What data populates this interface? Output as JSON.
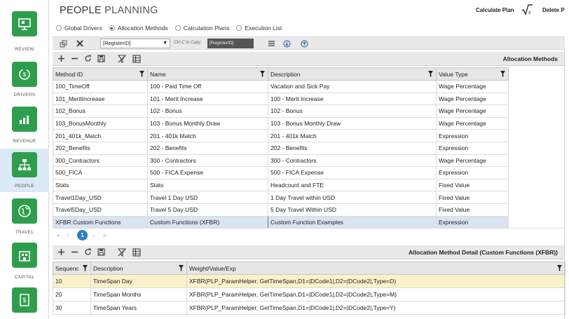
{
  "app": {
    "title_bold": "PEOPLE",
    "title_light": " PLANNING",
    "calculate_plan": "Calculate Plan",
    "delete_plan": "Delete P"
  },
  "sidebar": {
    "items": [
      {
        "label": "REVIEW",
        "icon": "presentation-icon"
      },
      {
        "label": "DRIVERS",
        "icon": "cycle-icon"
      },
      {
        "label": "REVENUE",
        "icon": "revenue-chart-icon"
      },
      {
        "label": "PEOPLE",
        "icon": "org-chart-icon"
      },
      {
        "label": "TRAVEL",
        "icon": "globe-icon"
      },
      {
        "label": "CAPITAL",
        "icon": "building-icon"
      },
      {
        "label": "",
        "icon": "dollar-document-icon"
      }
    ]
  },
  "tabs": [
    {
      "label": "Global Drivers",
      "selected": false
    },
    {
      "label": "Allocation Methods",
      "selected": true
    },
    {
      "label": "Calculation Plans",
      "selected": false
    },
    {
      "label": "Execution List",
      "selected": false
    }
  ],
  "toolbar": {
    "register_value": "[RegisterID]",
    "copy_label": "Ctrl-C to Copy:",
    "copy_value": "[RegisterID]"
  },
  "methods": {
    "title": "Allocation Methods",
    "columns": [
      "Method ID",
      "Name",
      "Description",
      "Value Type"
    ],
    "rows": [
      [
        "100_TimeOff",
        "100 - Paid Time Off",
        "Vacation and Sick Pay",
        "Wage Percentage"
      ],
      [
        "101_MeritIncrease",
        "101 - Merit Increase",
        "100 - Merit Increase",
        "Wage Percentage"
      ],
      [
        "102_Bonus",
        "102 - Bonus",
        "102 - Bonus",
        "Wage Percentage"
      ],
      [
        "103_BonusMonthly",
        "103 - Bonus Monthly Draw",
        "103 - Bonus Monthly Draw",
        "Wage Percentage"
      ],
      [
        "201_401k_Match",
        "201 - 401k Match",
        "201 - 401k Match",
        "Expression"
      ],
      [
        "202_Benefits",
        "202 - Benefits",
        "202 - Benefits",
        "Expression"
      ],
      [
        "300_Contractors",
        "300 - Contractors",
        "300 - Contractors",
        "Wage Percentage"
      ],
      [
        "500_FICA",
        "500 - FICA Expense",
        "500 - FICA Expense",
        "Expression"
      ],
      [
        "Stats",
        "Stats",
        "Headcount and FTE",
        "Fixed Value"
      ],
      [
        "Travel1Day_USD",
        "Travel 1 Day USD",
        "1 Day Travel within USD",
        "Fixed Value"
      ],
      [
        "Travel5Day_USD",
        "Travel 5 Day USD",
        "5 Day Travel Within USD",
        "Fixed Value"
      ],
      [
        "XFBR Custom Functions",
        "Custom Functions (XFBR)",
        "Custom Function Examples",
        "Expression"
      ]
    ]
  },
  "pager": {
    "first": "«",
    "prev": "‹",
    "page": "1",
    "next": "›",
    "last": "»"
  },
  "detail": {
    "title": "Allocation Method Detail (Custom Functions (XFBR))",
    "columns": [
      "Sequenc",
      "Description",
      "Weight/Value/Exp"
    ],
    "rows": [
      [
        "10",
        "TimeSpan Day",
        "XFBR(PLP_ParamHelper, GetTimeSpan,D1=|DCode1|,D2=|DCode2|,Type=D)"
      ],
      [
        "20",
        "TimeSpan Months",
        "XFBR(PLP_ParamHelper, GetTimeSpan,D1=|DCode1|,D2=|DCode2|,Type=M)"
      ],
      [
        "30",
        "TimeSpan Years",
        "XFBR(PLP_ParamHelper, GetTimeSpan,D1=|DCode1|,D2=|DCode2|,Type=Y)"
      ]
    ]
  },
  "colors": {
    "accent_green": "#2f9e4c",
    "selected_row": "#d9e3f1",
    "highlight_row": "#fbf1c9",
    "page_blue": "#2e7bc4"
  }
}
